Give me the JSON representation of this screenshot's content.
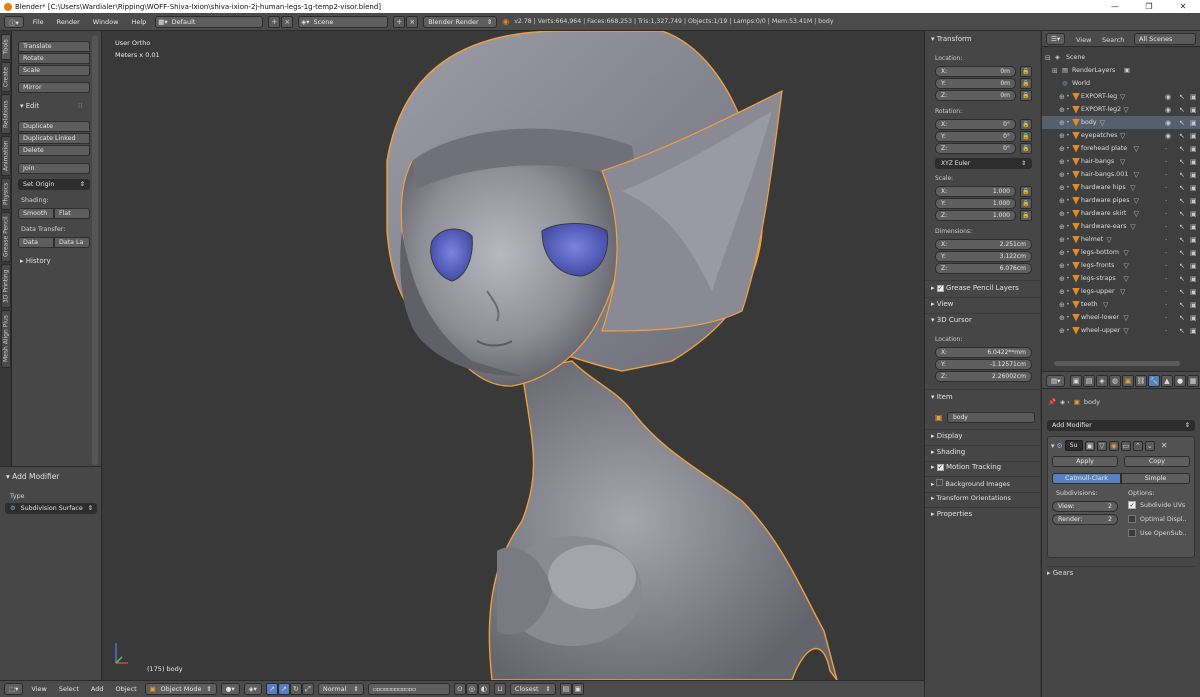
{
  "window": {
    "title": "Blender* [C:\\Users\\Wardialer\\Ripping\\WOFF-Shiva-Ixion\\shiva-ixion-2j-human-legs-1g-temp2-visor.blend]",
    "controls": [
      "—",
      "❐",
      "✕"
    ]
  },
  "infobar": {
    "menus": [
      "File",
      "Render",
      "Window",
      "Help"
    ],
    "layout": "Default",
    "scene": "Scene",
    "engine": "Blender Render",
    "stats": "v2.78 | Verts:664,964 | Faces:668,253 | Tris:1,327,749 | Objects:1/19 | Lamps:0/0 | Mem:53.41M | body"
  },
  "vtabs": [
    "Tools",
    "Create",
    "Relations",
    "Animation",
    "Physics",
    "Grease Pencil",
    "3D Printing",
    "Mesh Align Plus"
  ],
  "toolshelf": {
    "transform": [
      "Translate",
      "Rotate",
      "Scale"
    ],
    "mirror": "Mirror",
    "edit_header": "Edit",
    "edit": [
      "Duplicate",
      "Duplicate Linked",
      "Delete"
    ],
    "join": "Join",
    "set_origin": "Set Origin",
    "shading_label": "Shading:",
    "smooth": "Smooth",
    "flat": "Flat",
    "data_transfer_label": "Data Transfer:",
    "data": "Data",
    "data_la": "Data La",
    "history": "History"
  },
  "operator": {
    "header": "Add Modifier",
    "type_label": "Type",
    "type_value": "Subdivision Surface"
  },
  "viewport": {
    "view_name": "User Ortho",
    "scale": "Meters x 0.01",
    "frame_object": "(175) body"
  },
  "bottombar": {
    "menus": [
      "View",
      "Select",
      "Add",
      "Object"
    ],
    "mode": "Object Mode",
    "pivot": "Normal",
    "snap": "Closest"
  },
  "npanel": {
    "transform_header": "Transform",
    "location_label": "Location:",
    "location": [
      {
        "axis": "X:",
        "value": "0m"
      },
      {
        "axis": "Y:",
        "value": "0m"
      },
      {
        "axis": "Z:",
        "value": "0m"
      }
    ],
    "rotation_label": "Rotation:",
    "rotation": [
      {
        "axis": "X:",
        "value": "0°"
      },
      {
        "axis": "Y:",
        "value": "0°"
      },
      {
        "axis": "Z:",
        "value": "0°"
      }
    ],
    "rotation_mode": "XYZ Euler",
    "scale_label": "Scale:",
    "scale": [
      {
        "axis": "X:",
        "value": "1.000"
      },
      {
        "axis": "Y:",
        "value": "1.000"
      },
      {
        "axis": "Z:",
        "value": "1.000"
      }
    ],
    "dimensions_label": "Dimensions:",
    "dimensions": [
      {
        "axis": "X:",
        "value": "2.251cm"
      },
      {
        "axis": "Y:",
        "value": "3.122cm"
      },
      {
        "axis": "Z:",
        "value": "6.076cm"
      }
    ],
    "grease_pencil": "Grease Pencil Layers",
    "view": "View",
    "cursor_header": "3D Cursor",
    "cursor_location_label": "Location:",
    "cursor": [
      {
        "axis": "X:",
        "value": "6.0422**mm"
      },
      {
        "axis": "Y:",
        "value": "-1.12571cm"
      },
      {
        "axis": "Z:",
        "value": "2.26002cm"
      }
    ],
    "item_header": "Item",
    "item_name": "body",
    "collapsed": [
      "Display",
      "Shading",
      "Motion Tracking",
      "Background Images",
      "Transform Orientations",
      "Properties"
    ]
  },
  "outliner": {
    "tabs": [
      "View",
      "Search",
      "All Scenes"
    ],
    "scene": "Scene",
    "render_layers": "RenderLayers",
    "world": "World",
    "objects": [
      "EXPORT-leg",
      "EXPORT-leg2",
      "body",
      "eyepatches",
      "forehead plate",
      "hair-bangs",
      "hair-bangs.001",
      "hardware hips",
      "hardware pipes",
      "hardware skirt",
      "hardware-ears",
      "helmet",
      "legs-bottom",
      "legs-fronts",
      "legs-straps",
      "legs-upper",
      "teeth",
      "wheel-lower",
      "wheel-upper"
    ]
  },
  "properties": {
    "context_object": "body",
    "add_modifier": "Add Modifier",
    "modifier_short": "Su",
    "apply": "Apply",
    "copy": "Copy",
    "catmull": "Catmull-Clark",
    "simple": "Simple",
    "subdivisions_label": "Subdivisions:",
    "options_label": "Options:",
    "view_field": {
      "label": "View:",
      "value": "2"
    },
    "render_field": {
      "label": "Render:",
      "value": "2"
    },
    "opt_uvs": "Subdivide UVs",
    "opt_optimal": "Optimal Displ..",
    "opt_gpu": "Use OpenSub..",
    "gears": "Gears"
  },
  "colors": {
    "accent": "#5680c2",
    "selection_outline": "#f0a040",
    "mesh": "#8e8e96",
    "eye": "#5a64c8"
  }
}
